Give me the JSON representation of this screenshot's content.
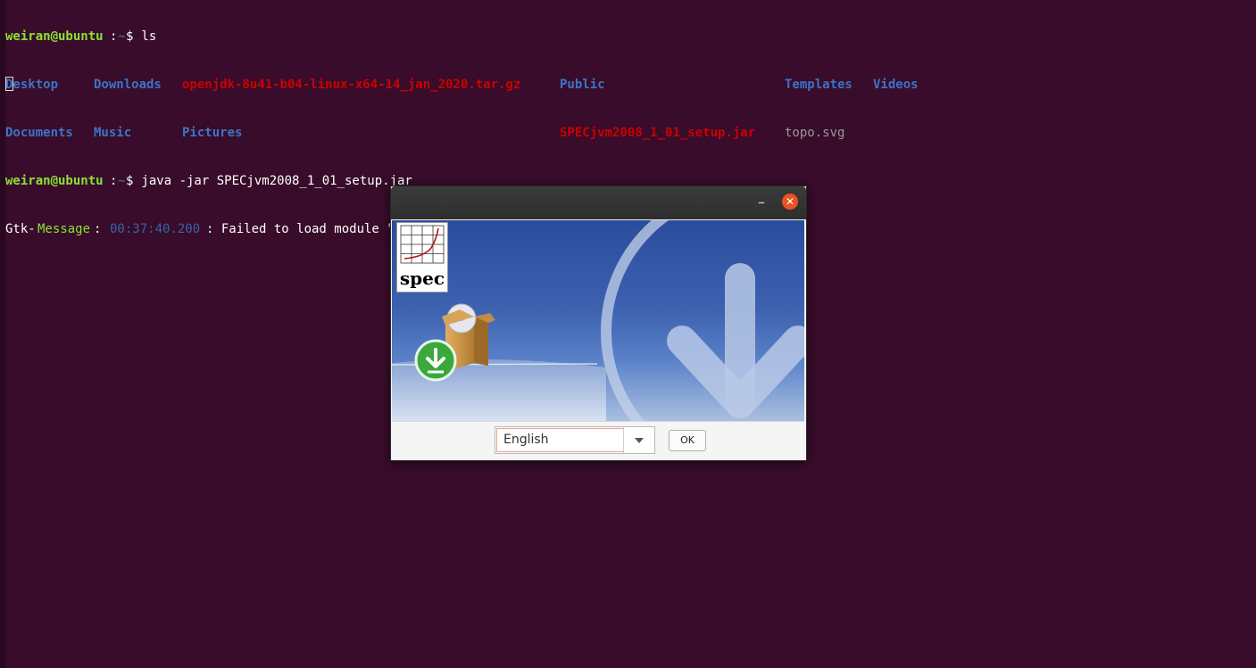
{
  "terminal": {
    "prompt_user": "weiran@ubuntu",
    "prompt_sep": ":",
    "prompt_path": "~",
    "prompt_dollar": "$",
    "cmd1": " ls",
    "files_row1": [
      "Desktop",
      "Downloads",
      "openjdk-8u41-b04-linux-x64-14_jan_2020.tar.gz",
      "Public",
      "Templates",
      "Videos"
    ],
    "files_row2": [
      "Documents",
      "Music",
      "Pictures",
      "SPECjvm2008_1_01_setup.jar",
      "topo.svg"
    ],
    "cmd2": " java -jar SPECjvm2008_1_01_setup.jar",
    "msg_gtk": "Gtk-",
    "msg_label": "Message",
    "msg_colon": ": ",
    "msg_time": "00:37:40.200",
    "msg_text": ": Failed to load module \"canberra-gtk-module\""
  },
  "dialog": {
    "minimize_symbol": "–",
    "close_symbol": "✕",
    "logo_text": "spec",
    "language_value": "English",
    "ok_label": "OK"
  },
  "colors": {
    "terminal_bg": "#380c2a",
    "prompt_green": "#8ae234",
    "dir_blue": "#3465a4",
    "archive_red": "#cc0000",
    "close_orange": "#e95420"
  }
}
